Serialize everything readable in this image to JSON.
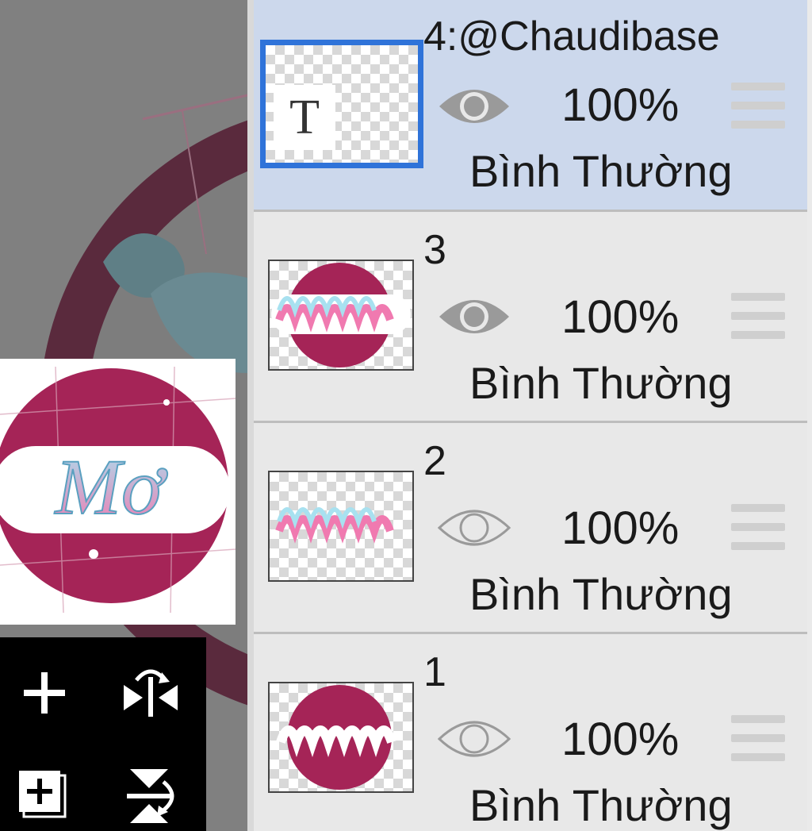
{
  "colors": {
    "accent": "#2f73d9",
    "selected_row": "#ccd8ec",
    "row": "#e8e8e8",
    "canvas_gray": "#808080",
    "magenta": "#a52457"
  },
  "toolbar": {
    "add_layer_icon": "plus-icon",
    "flip_horizontal_icon": "flip-horizontal-icon",
    "add_special_layer_icon": "add-layer-box-icon",
    "flip_vertical_icon": "flip-vertical-icon"
  },
  "preview": {
    "artwork_text": "Mơ"
  },
  "layers": [
    {
      "name": "4:@Chaudibase",
      "opacity": "100%",
      "blend": "Bình Thường",
      "visible": true,
      "selected": true,
      "thumb_glyph": "T"
    },
    {
      "name": "3",
      "opacity": "100%",
      "blend": "Bình Thường",
      "visible": true,
      "selected": false
    },
    {
      "name": "2",
      "opacity": "100%",
      "blend": "Bình Thường",
      "visible": false,
      "selected": false
    },
    {
      "name": "1",
      "opacity": "100%",
      "blend": "Bình Thường",
      "visible": false,
      "selected": false
    }
  ]
}
